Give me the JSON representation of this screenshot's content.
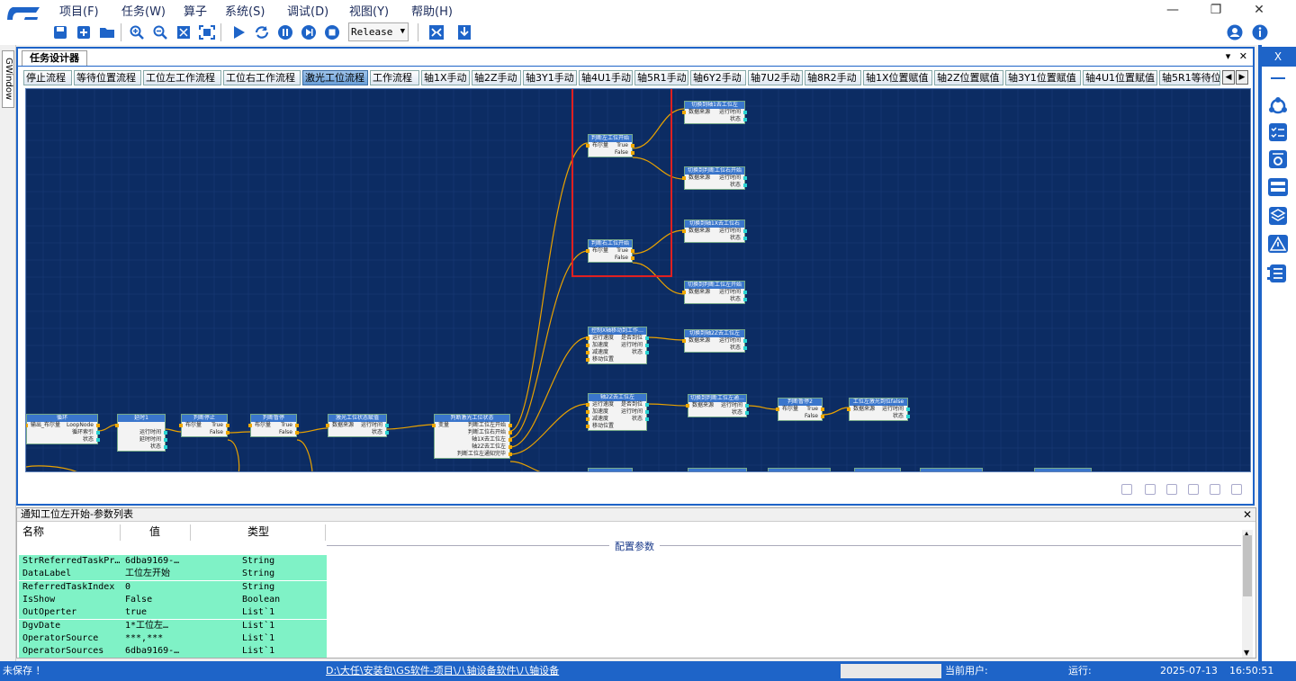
{
  "menu": [
    "项目(F)",
    "任务(W)",
    "算子",
    "系统(S)",
    "调试(D)",
    "视图(Y)",
    "帮助(H)"
  ],
  "window_controls": {
    "minimize": "—",
    "restore": "❐",
    "close": "✕"
  },
  "toolbar": {
    "config_value": "Release"
  },
  "left_gutter_tab": "GWindow",
  "doc": {
    "title": "任务设计器",
    "pin": "▾",
    "close": "✕"
  },
  "flow_tabs": [
    "停止流程",
    "等待位置流程",
    "工位左工作流程",
    "工位右工作流程",
    "激光工位流程",
    "工作流程",
    "轴1X手动",
    "轴2Z手动",
    "轴3Y1手动",
    "轴4U1手动",
    "轴5R1手动",
    "轴6Y2手动",
    "轴7U2手动",
    "轴8R2手动",
    "轴1X位置赋值",
    "轴2Z位置赋值",
    "轴3Y1位置赋值",
    "轴4U1位置赋值",
    "轴5R1等待位置"
  ],
  "active_tab_index": 4,
  "tab_arrows": {
    "left": "◀",
    "right": "▶"
  },
  "nodes": [
    {
      "title": "循环",
      "rows": [
        [
          "输出_布尔量",
          "LoopNode"
        ],
        [
          "",
          "循环索引"
        ],
        [
          "",
          "状态"
        ]
      ]
    },
    {
      "title": "延时1",
      "rows": [
        [
          "",
          ""
        ],
        [
          "",
          "运行时间"
        ],
        [
          "",
          "延时时间"
        ],
        [
          "",
          "状态"
        ]
      ]
    },
    {
      "title": "判断停止",
      "rows": [
        [
          "布尔量",
          "True"
        ],
        [
          "",
          "False"
        ]
      ]
    },
    {
      "title": "判断暂停",
      "rows": [
        [
          "布尔量",
          "True"
        ],
        [
          "",
          "False"
        ]
      ]
    },
    {
      "title": "激光工位状态赋值",
      "rows": [
        [
          "数据来源",
          "运行时间"
        ],
        [
          "",
          "状态"
        ]
      ]
    },
    {
      "title": "判断激光工位状态",
      "rows": [
        [
          "变量",
          "判断工位左开始"
        ],
        [
          "",
          "判断工位右开始"
        ],
        [
          "",
          "轴1X去工位左"
        ],
        [
          "",
          "轴2Z去工位左"
        ],
        [
          "",
          "判断工位左通知完毕"
        ]
      ]
    },
    {
      "title": "判断左工位开始",
      "rows": [
        [
          "布尔量",
          "True"
        ],
        [
          "",
          "False"
        ]
      ]
    },
    {
      "title": "判断右工位开始",
      "rows": [
        [
          "布尔量",
          "True"
        ],
        [
          "",
          "False"
        ]
      ]
    },
    {
      "title": "切换到轴1去工位左",
      "rows": [
        [
          "数据来源",
          "运行时间"
        ],
        [
          "",
          "状态"
        ]
      ]
    },
    {
      "title": "切换到判断工位右开始",
      "rows": [
        [
          "数据来源",
          "运行时间"
        ],
        [
          "",
          "状态"
        ]
      ]
    },
    {
      "title": "切换到轴1X去工位右",
      "rows": [
        [
          "数据来源",
          "运行时间"
        ],
        [
          "",
          "状态"
        ]
      ]
    },
    {
      "title": "切换到判断工位左开始",
      "rows": [
        [
          "数据来源",
          "运行时间"
        ],
        [
          "",
          "状态"
        ]
      ]
    },
    {
      "title": "控制X轴移动到工作…",
      "rows": [
        [
          "运行速度",
          "是否到位"
        ],
        [
          "加速度",
          "运行时间"
        ],
        [
          "减速度",
          "状态"
        ],
        [
          "移动位置",
          ""
        ]
      ]
    },
    {
      "title": "切换到轴2Z去工位左",
      "rows": [
        [
          "数据来源",
          "运行时间"
        ],
        [
          "",
          "状态"
        ]
      ]
    },
    {
      "title": "轴2Z去工位左",
      "rows": [
        [
          "运行速度",
          "是否到位"
        ],
        [
          "加速度",
          "运行时间"
        ],
        [
          "减速度",
          "状态"
        ],
        [
          "移动位置",
          ""
        ]
      ]
    },
    {
      "title": "切换到判断工位左通…",
      "rows": [
        [
          "数据来源",
          "运行时间"
        ],
        [
          "",
          "状态"
        ]
      ]
    },
    {
      "title": "判断暂停2",
      "rows": [
        [
          "布尔量",
          "True"
        ],
        [
          "",
          "False"
        ]
      ]
    },
    {
      "title": "工位左激光到位false",
      "rows": [
        [
          "数据来源",
          "运行时间"
        ],
        [
          "",
          "状态"
        ]
      ]
    }
  ],
  "canvas_tools": [
    "add-node-icon",
    "copy-node-icon",
    "paste-icon",
    "duplicate-icon",
    "delete-icon",
    "clear-icon"
  ],
  "params": {
    "panel_title": "通知工位左开始-参数列表",
    "close": "✕",
    "headers": {
      "name": "名称",
      "value": "值",
      "type": "类型"
    },
    "section_label": "配置参数",
    "rows": [
      {
        "name": "StrReferredTaskPr…",
        "value": "6dba9169-…",
        "type": "String"
      },
      {
        "name": "DataLabel",
        "value": "工位左开始",
        "type": "String"
      },
      {
        "name": "ReferredTaskIndex",
        "value": "0",
        "type": "String"
      },
      {
        "name": "IsShow",
        "value": "False",
        "type": "Boolean"
      },
      {
        "name": "OutOperter",
        "value": "true",
        "type": "List`1"
      },
      {
        "name": "DgvDate",
        "value": "1*工位左…",
        "type": "List`1"
      },
      {
        "name": "OperatorSource",
        "value": "***,***",
        "type": "List`1"
      },
      {
        "name": "OperatorSources",
        "value": "6dba9169-…",
        "type": "List`1"
      }
    ]
  },
  "sidebar": {
    "close": "X",
    "icons": [
      "minus-icon",
      "network-icon",
      "checklist-icon",
      "settings-list-icon",
      "panel-icon",
      "layers-icon",
      "warning-icon",
      "flow-list-icon"
    ]
  },
  "status": {
    "left": "未保存 ！",
    "path": "D:\\大任\\安装包\\GS软件-项目\\八轴设备软件\\八轴设备",
    "user_label": "当前用户:",
    "run_label": "运行:",
    "date": "2025-07-13",
    "time": "16:50:51"
  },
  "colors": {
    "accent": "#1e64c8",
    "canvas": "#0c2c63",
    "node_header": "#3a76cc",
    "wire": "#e8a100",
    "param_row": "#7ff2c6",
    "highlight": "#e02020"
  }
}
